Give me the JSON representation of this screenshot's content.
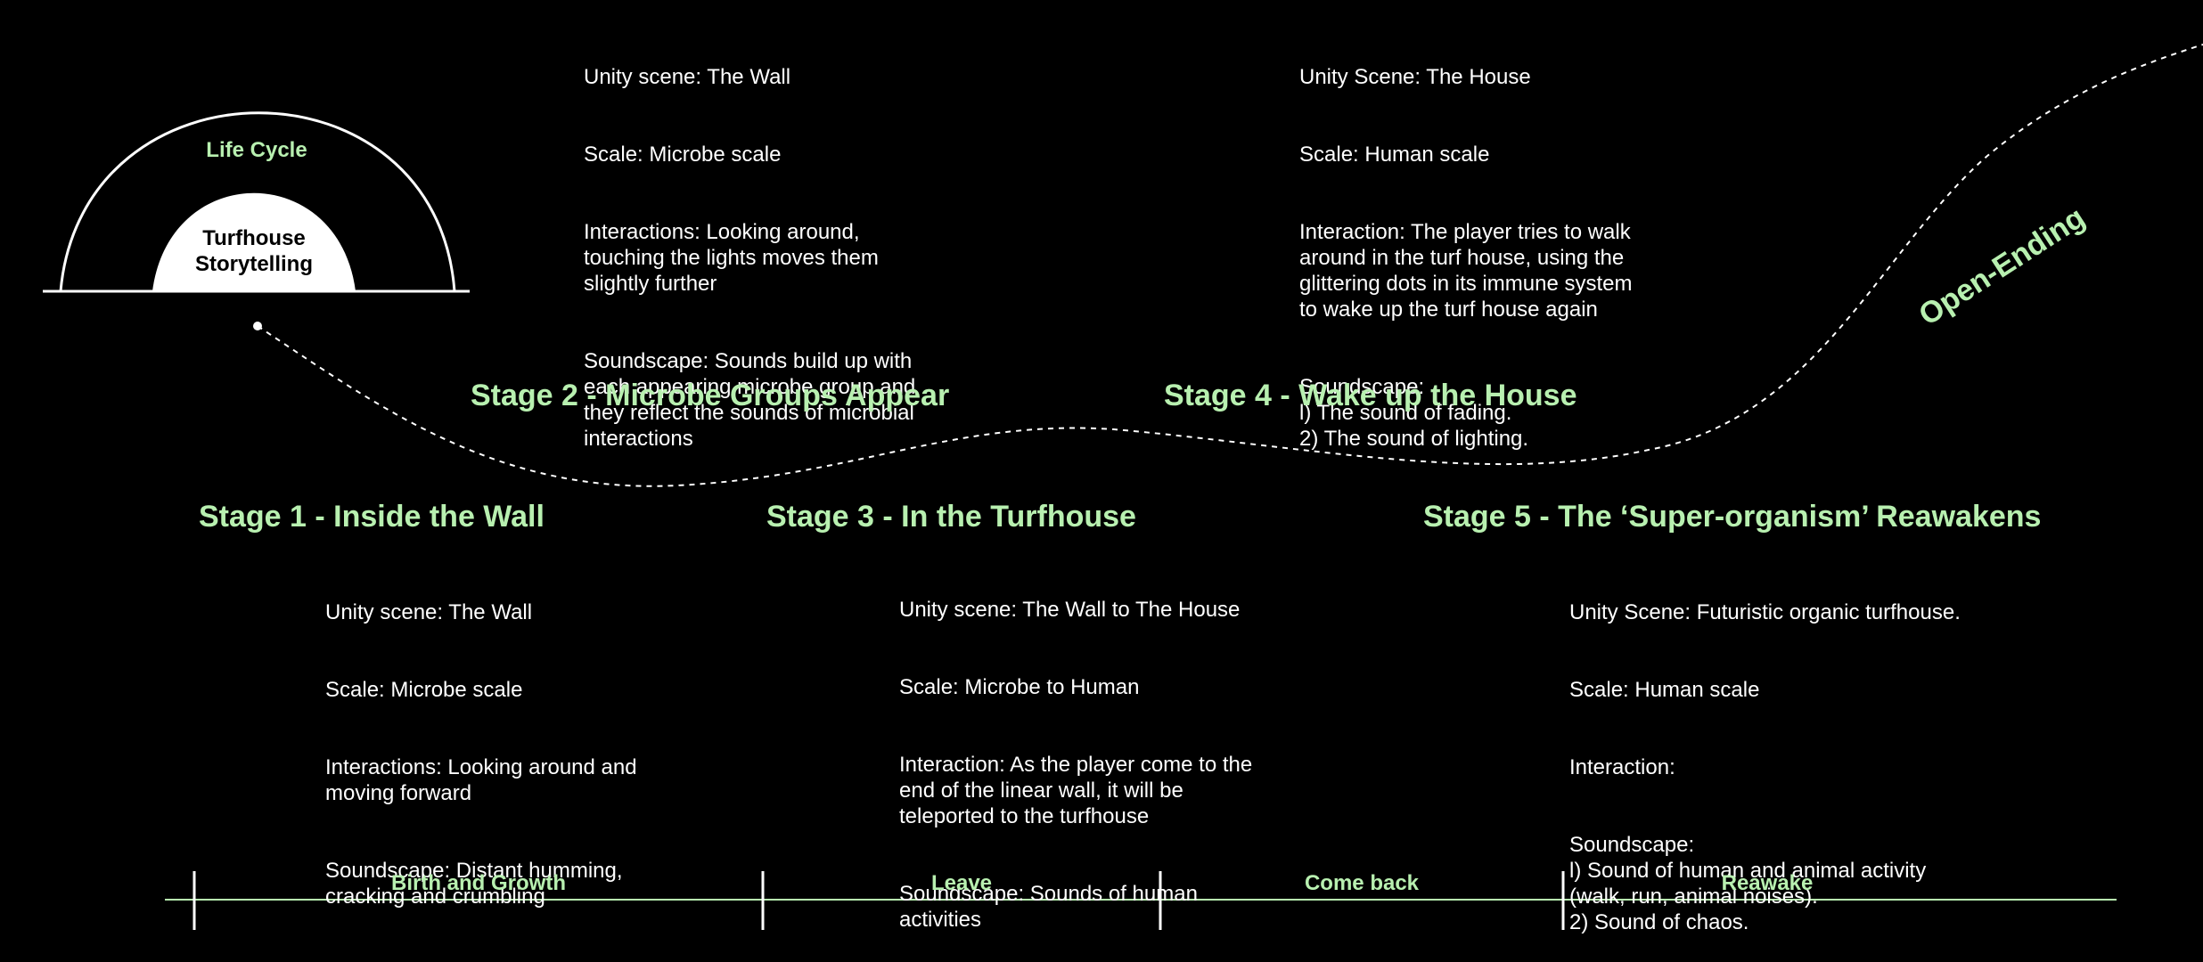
{
  "colors": {
    "background": "#000000",
    "accent": "#b8f0b0",
    "text": "#ffffff"
  },
  "dome": {
    "outer_label": "Life Cycle",
    "inner_label": "Turfhouse\nStorytelling"
  },
  "open_ending": "Open-Ending",
  "stages": [
    {
      "title": "Stage 1 - Inside the Wall",
      "scene": "Unity scene: The Wall",
      "scale": "Scale: Microbe scale",
      "interaction": "Interactions: Looking around and\nmoving forward",
      "soundscape": "Soundscape: Distant humming,\ncracking and crumbling"
    },
    {
      "title": "Stage 2 - Microbe Groups Appear",
      "scene": "Unity scene: The Wall",
      "scale": "Scale: Microbe scale",
      "interaction": "Interactions: Looking around,\ntouching the lights moves them\nslightly further",
      "soundscape": "Soundscape: Sounds build up with\neach appearing microbe group and\nthey reflect the sounds of microbial\ninteractions"
    },
    {
      "title": "Stage 3 - In the Turfhouse",
      "scene": "Unity scene: The Wall to The House",
      "scale": "Scale: Microbe to Human",
      "interaction": "Interaction: As the player come to the\nend of the linear wall, it will be\nteleported to the turfhouse",
      "soundscape": "Soundscape: Sounds of human\nactivities"
    },
    {
      "title": "Stage 4 - Wake up the House",
      "scene": "Unity Scene: The House",
      "scale": "Scale: Human scale",
      "interaction": "Interaction: The player tries to walk\naround in the turf house, using the\nglittering dots in its immune system\nto wake up the turf house again",
      "soundscape": "Soundscape:\nl) The sound of fading.\n2) The sound of lighting."
    },
    {
      "title": "Stage 5 - The ‘Super-organism’ Reawakens",
      "scene": "Unity Scene: Futuristic organic turfhouse.",
      "scale": "Scale: Human scale",
      "interaction": "Interaction:",
      "soundscape": "Soundscape:\nl) Sound of human and animal activity\n(walk, run, animal noises).\n2) Sound of chaos."
    }
  ],
  "phases": [
    "Birth and Growth",
    "Leave",
    "Come back",
    "Reawake"
  ]
}
